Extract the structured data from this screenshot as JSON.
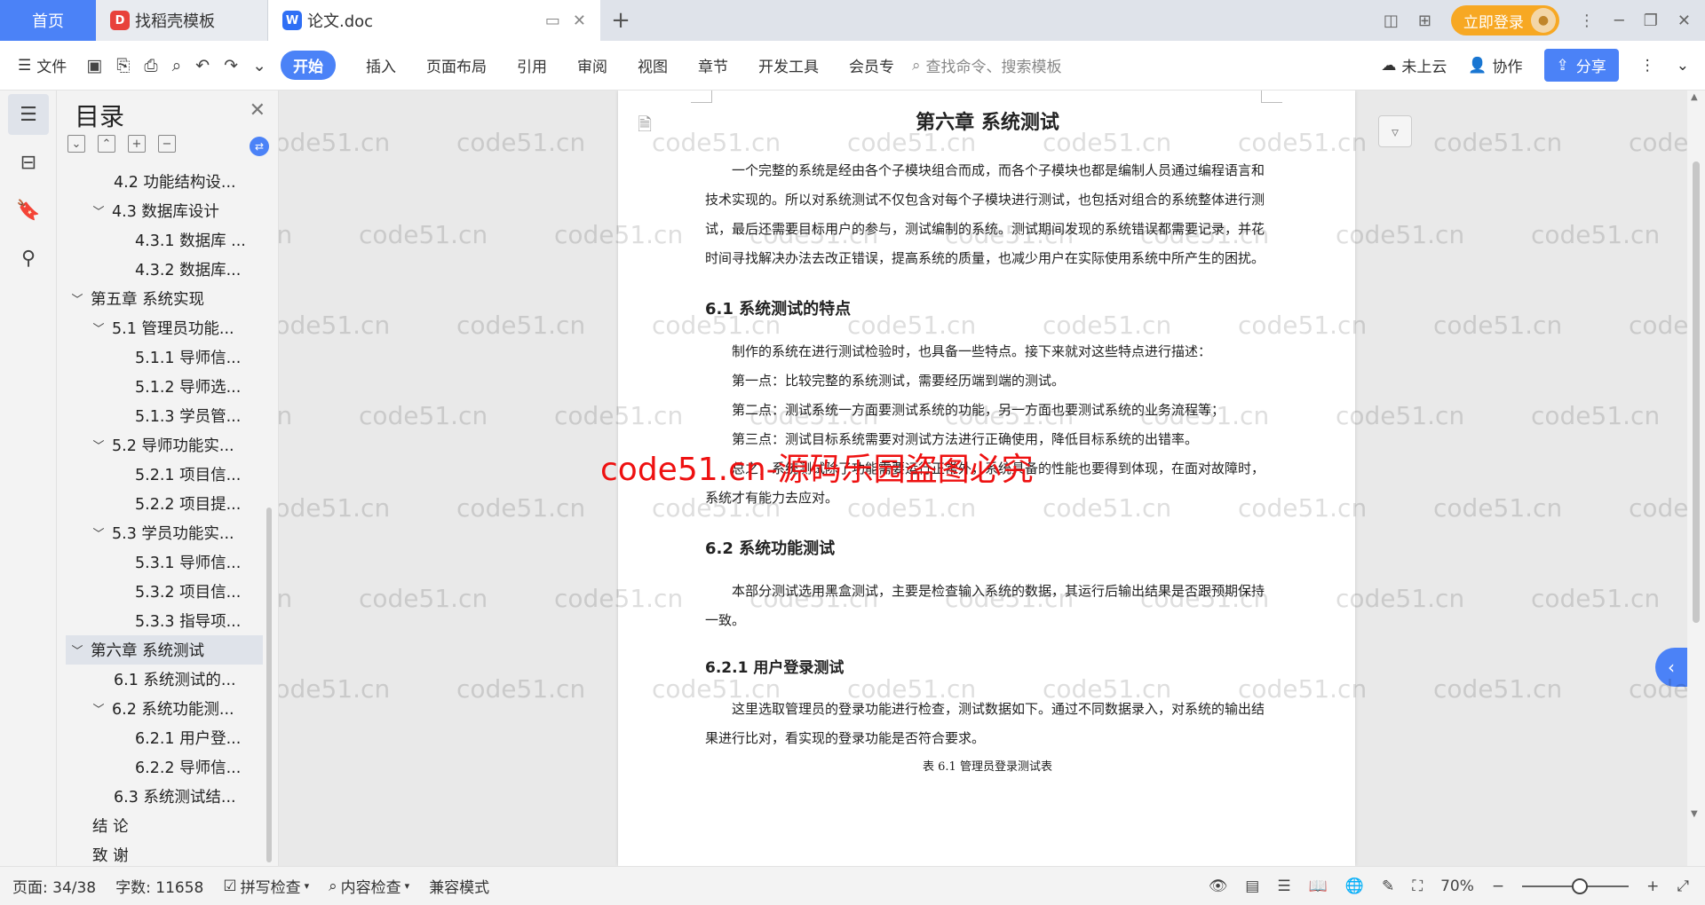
{
  "tabs": {
    "home": "首页",
    "tab1": "找稻壳模板",
    "tab2": "论文.doc",
    "new_tab": "+",
    "login": "立即登录"
  },
  "ribbon": {
    "file": "文件",
    "active_tab": "开始",
    "tabs": [
      "插入",
      "页面布局",
      "引用",
      "审阅",
      "视图",
      "章节",
      "开发工具",
      "会员专"
    ],
    "search_placeholder": "查找命令、搜索模板",
    "cloud": "未上云",
    "collab": "协作",
    "share": "分享"
  },
  "toc": {
    "title": "目录",
    "items": [
      {
        "label": "4.2 功能结构设...",
        "level": "l2n",
        "chev": ""
      },
      {
        "label": "4.3 数据库设计",
        "level": "l2",
        "chev": "﹀"
      },
      {
        "label": "4.3.1 数据库 ...",
        "level": "l3",
        "chev": ""
      },
      {
        "label": "4.3.2 数据库...",
        "level": "l3",
        "chev": ""
      },
      {
        "label": "第五章 系统实现",
        "level": "l1",
        "chev": "﹀"
      },
      {
        "label": "5.1 管理员功能...",
        "level": "l2",
        "chev": "﹀"
      },
      {
        "label": "5.1.1 导师信...",
        "level": "l3",
        "chev": ""
      },
      {
        "label": "5.1.2 导师选...",
        "level": "l3",
        "chev": ""
      },
      {
        "label": "5.1.3 学员管...",
        "level": "l3",
        "chev": ""
      },
      {
        "label": "5.2 导师功能实...",
        "level": "l2",
        "chev": "﹀"
      },
      {
        "label": "5.2.1 项目信...",
        "level": "l3",
        "chev": ""
      },
      {
        "label": "5.2.2 项目提...",
        "level": "l3",
        "chev": ""
      },
      {
        "label": "5.3 学员功能实...",
        "level": "l2",
        "chev": "﹀"
      },
      {
        "label": "5.3.1 导师信...",
        "level": "l3",
        "chev": ""
      },
      {
        "label": "5.3.2 项目信...",
        "level": "l3",
        "chev": ""
      },
      {
        "label": "5.3.3 指导项...",
        "level": "l3",
        "chev": ""
      },
      {
        "label": "第六章 系统测试",
        "level": "l1",
        "chev": "﹀",
        "active": true
      },
      {
        "label": "6.1 系统测试的...",
        "level": "l2n",
        "chev": ""
      },
      {
        "label": "6.2 系统功能测...",
        "level": "l2",
        "chev": "﹀"
      },
      {
        "label": "6.2.1 用户登...",
        "level": "l3",
        "chev": ""
      },
      {
        "label": "6.2.2 导师信...",
        "level": "l3",
        "chev": ""
      },
      {
        "label": "6.3 系统测试结...",
        "level": "l2n",
        "chev": ""
      },
      {
        "label": "结 论",
        "level": "l1n",
        "chev": ""
      },
      {
        "label": "致 谢",
        "level": "l1n",
        "chev": ""
      }
    ]
  },
  "document": {
    "chapter_title": "第六章 系统测试",
    "intro": "一个完整的系统是经由各个子模块组合而成，而各个子模块也都是编制人员通过编程语言和技术实现的。所以对系统测试不仅包含对每个子模块进行测试，也包括对组合的系统整体进行测试，最后还需要目标用户的参与，测试编制的系统。测试期间发现的系统错误都需要记录，并花时间寻找解决办法去改正错误，提高系统的质量，也减少用户在实际使用系统中所产生的困扰。",
    "s61_title": "6.1 系统测试的特点",
    "s61_p1": "制作的系统在进行测试检验时，也具备一些特点。接下来就对这些特点进行描述：",
    "s61_p2": "第一点：比较完整的系统测试，需要经历端到端的测试。",
    "s61_p3": "第二点：测试系统一方面要测试系统的功能，另一方面也要测试系统的业务流程等；",
    "s61_p4": "第三点：测试目标系统需要对测试方法进行正确使用，降低目标系统的出错率。",
    "s61_p5": "总之，系统测试除了功能需要运行正常外，系统具备的性能也要得到体现，在面对故障时，系统才有能力去应对。",
    "s62_title": "6.2 系统功能测试",
    "s62_p1": "本部分测试选用黑盒测试，主要是检查输入系统的数据，其运行后输出结果是否跟预期保持一致。",
    "s621_title": "6.2.1 用户登录测试",
    "s621_p1": "这里选取管理员的登录功能进行检查，测试数据如下。通过不同数据录入，对系统的输出结果进行比对，看实现的登录功能是否符合要求。",
    "table_caption": "表 6.1 管理员登录测试表"
  },
  "watermark": {
    "red_text": "code51.cn-源码乐园盗图必究",
    "grey_text": "code51.cn"
  },
  "status": {
    "page": "页面: 34/38",
    "words": "字数: 11658",
    "spell": "拼写检查",
    "content": "内容检查",
    "compat": "兼容模式",
    "zoom": "70%"
  }
}
